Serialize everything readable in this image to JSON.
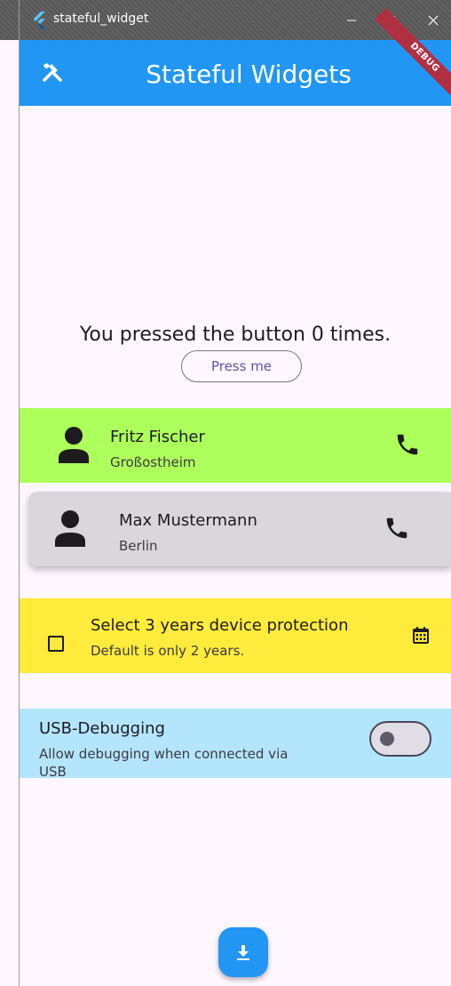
{
  "window": {
    "title": "stateful_widget",
    "controls": {
      "minimize_icon": "minimize-icon",
      "maximize_icon": "maximize-icon",
      "close_icon": "close-icon"
    }
  },
  "appbar": {
    "title": "Stateful Widgets",
    "leading_icon": "tools-icon",
    "color": "#2196f3",
    "debug_banner": "DEBUG"
  },
  "counter": {
    "text": "You pressed the button 0 times.",
    "button_label": "Press me"
  },
  "contacts": [
    {
      "name": "Fritz Fischer",
      "city": "Großostheim",
      "color": "#adff5c"
    },
    {
      "name": "Max Mustermann",
      "city": "Berlin",
      "color": "#d9d6dc"
    }
  ],
  "protection": {
    "title": "Select 3 years device protection",
    "subtitle": "Default is only 2 years.",
    "checked": false,
    "color": "#ffeb3b"
  },
  "usb": {
    "title": "USB-Debugging",
    "subtitle_line1": "Allow debugging when connected via",
    "subtitle_line2": "USB",
    "enabled": false,
    "color": "#b3e5fc"
  },
  "fab": {
    "icon": "download-icon"
  }
}
